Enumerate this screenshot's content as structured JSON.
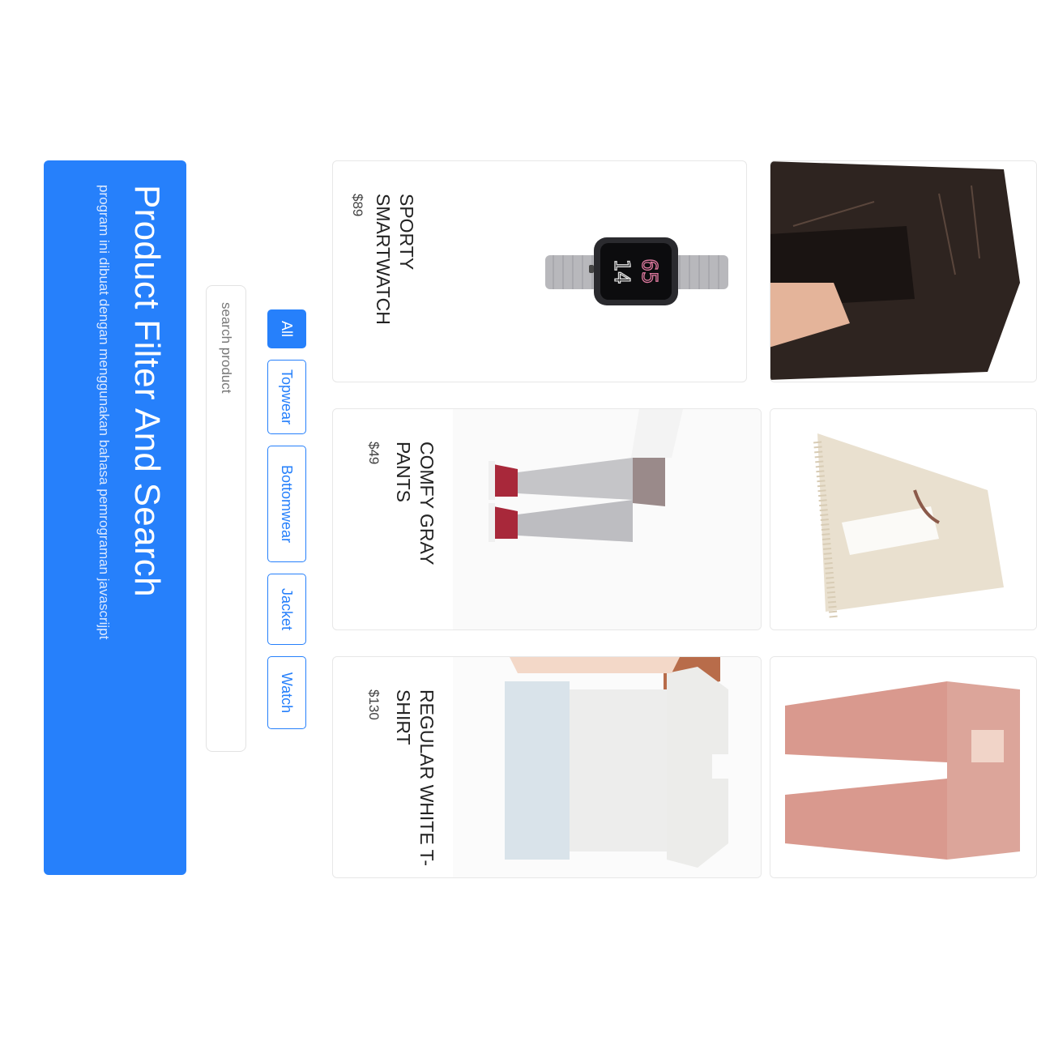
{
  "header": {
    "title": "Product Filter And Search",
    "subtitle": "program ini dibuat dengan menggunakan bahasa pemrograman javascrijpt"
  },
  "search": {
    "placeholder": "search product",
    "value": ""
  },
  "filters": [
    {
      "label": "All",
      "active": true
    },
    {
      "label": "Topwear",
      "active": false
    },
    {
      "label": "Bottomwear",
      "active": false
    },
    {
      "label": "Jacket",
      "active": false
    },
    {
      "label": "Watch",
      "active": false
    }
  ],
  "products": [
    {
      "name": "SPORTY SMARTWATCH",
      "price": "$89",
      "category": "Watch"
    },
    {
      "name": "COMFY GRAY PANTS",
      "price": "$49",
      "category": "Bottomwear"
    },
    {
      "name": "REGULAR WHITE T-SHIRT",
      "price": "$130",
      "category": "Topwear"
    },
    {
      "name": "",
      "price": "",
      "category": "Jacket"
    },
    {
      "name": "",
      "price": "",
      "category": "Topwear"
    },
    {
      "name": "",
      "price": "",
      "category": "Bottomwear"
    }
  ],
  "colors": {
    "accent": "#2680fb",
    "subtitle": "#dce9ff",
    "border": "#e7e7e7"
  },
  "watch_face": {
    "line1": "65",
    "line2": "14"
  }
}
